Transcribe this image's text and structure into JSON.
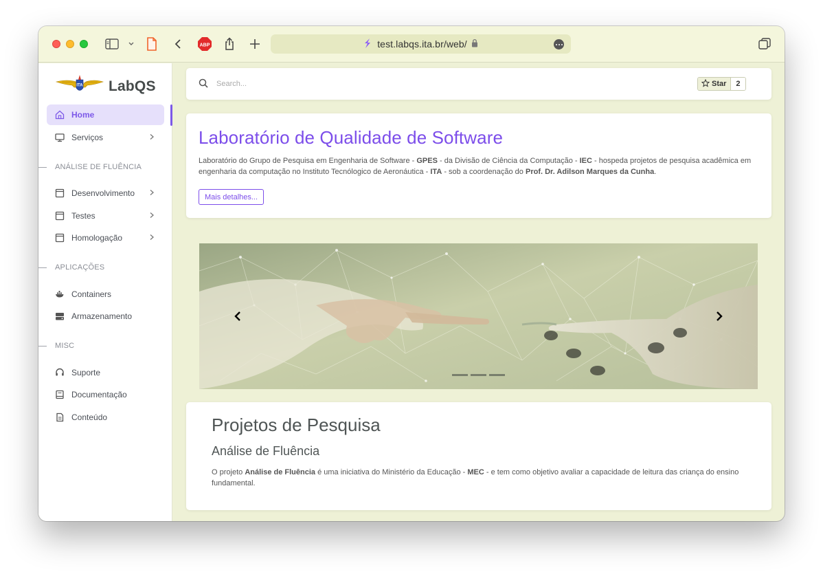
{
  "browser": {
    "url": "test.labqs.ita.br/web/"
  },
  "brand": {
    "name": "LabQS"
  },
  "sidebar": {
    "items": [
      {
        "label": "Home",
        "icon": "home-icon",
        "active": true
      },
      {
        "label": "Serviços",
        "icon": "monitor-icon"
      },
      {
        "label": "Desenvolvimento",
        "icon": "window-icon"
      },
      {
        "label": "Testes",
        "icon": "window-icon"
      },
      {
        "label": "Homologação",
        "icon": "window-icon"
      },
      {
        "label": "Containers",
        "icon": "docker-icon"
      },
      {
        "label": "Armazenamento",
        "icon": "storage-icon"
      },
      {
        "label": "Suporte",
        "icon": "headset-icon"
      },
      {
        "label": "Documentação",
        "icon": "book-icon"
      },
      {
        "label": "Conteúdo",
        "icon": "document-icon"
      }
    ],
    "sections": [
      "ANÁLISE DE FLUÊNCIA",
      "APLICAÇÕES",
      "MISC"
    ]
  },
  "search": {
    "placeholder": "Search...",
    "star_label": "Star",
    "star_count": "2"
  },
  "hero": {
    "title": "Laboratório de Qualidade de Software",
    "parts": [
      "Laboratório do Grupo de Pesquisa em Engenharia de Software - ",
      "GPES",
      " - da Divisão de Ciência da Computação - ",
      "IEC",
      " - hospeda projetos de pesquisa acadêmica em engenharia da computação no Instituto Tecnólogico de Aeronáutica - ",
      "ITA",
      " - sob a coordenação do ",
      "Prof. Dr. Adilson Marques da Cunha",
      "."
    ],
    "button": "Mais detalhes..."
  },
  "projects": {
    "title": "Projetos de Pesquisa",
    "subtitle": "Análise de Fluência",
    "parts": [
      "O projeto ",
      "Análise de Fluência",
      " é uma iniciativa do Ministério da Educação - ",
      "MEC",
      " - e tem como objetivo avaliar a capacidade de leitura das criança do ensino fundamental."
    ]
  },
  "colors": {
    "accent": "#7c4dea",
    "page_background": "#eef1d6",
    "active_nav_bg": "#e6e0fb"
  }
}
